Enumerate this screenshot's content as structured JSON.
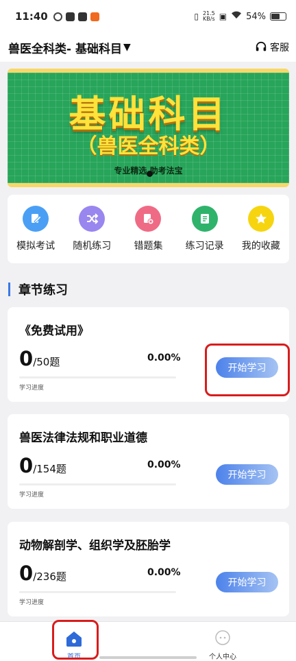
{
  "status_bar": {
    "time": "11:40",
    "network_speed_value": "21.5",
    "network_speed_unit": "KB/s",
    "battery": "54%"
  },
  "header": {
    "title": "兽医全科类- 基础科目",
    "service_label": "客服"
  },
  "banner": {
    "headline": "基础科目",
    "subtitle": "（兽医全科类）",
    "slogan": "专业精选 助考法宝"
  },
  "quick_actions": [
    {
      "label": "模拟考试",
      "icon": "exam-edit-icon",
      "color": "#4a9ff5"
    },
    {
      "label": "随机练习",
      "icon": "shuffle-icon",
      "color": "#9a86ef"
    },
    {
      "label": "错题集",
      "icon": "wrong-questions-icon",
      "color": "#ef6b85"
    },
    {
      "label": "练习记录",
      "icon": "record-icon",
      "color": "#2fb36b"
    },
    {
      "label": "我的收藏",
      "icon": "star-icon",
      "color": "#f6d510"
    }
  ],
  "section": {
    "title": "章节练习"
  },
  "chapters": [
    {
      "title": "《免费试用》",
      "done": "0",
      "total": "/50题",
      "percent": "0.00%",
      "progress": 0,
      "progress_label": "学习进度",
      "button": "开始学习"
    },
    {
      "title": "兽医法律法规和职业道德",
      "done": "0",
      "total": "/154题",
      "percent": "0.00%",
      "progress": 0,
      "progress_label": "学习进度",
      "button": "开始学习"
    },
    {
      "title": "动物解剖学、组织学及胚胎学",
      "done": "0",
      "total": "/236题",
      "percent": "0.00%",
      "progress": 0,
      "progress_label": "学习进度",
      "button": "开始学习"
    }
  ],
  "tab_bar": {
    "home": "首页",
    "profile": "个人中心"
  },
  "colors": {
    "accent": "#3a78e6",
    "highlight": "#d81c1c"
  }
}
